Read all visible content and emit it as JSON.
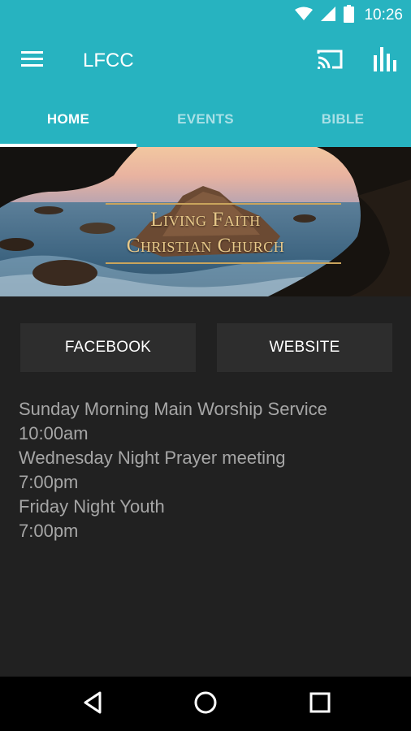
{
  "status_bar": {
    "time": "10:26",
    "icons": [
      "wifi-icon",
      "cell-signal-icon",
      "battery-icon"
    ]
  },
  "app_bar": {
    "title": "LFCC",
    "icons": [
      "menu-icon",
      "cast-icon",
      "bar-chart-icon"
    ],
    "background_color": "#27b3c0"
  },
  "tabs": [
    {
      "label": "HOME",
      "active": true
    },
    {
      "label": "EVENTS",
      "active": false
    },
    {
      "label": "BIBLE",
      "active": false
    }
  ],
  "banner": {
    "line1": "Living Faith",
    "line2": "Christian Church"
  },
  "buttons": {
    "facebook_label": "FACEBOOK",
    "website_label": "WEBSITE"
  },
  "schedule": [
    "Sunday Morning Main Worship Service",
    "10:00am",
    "Wednesday Night Prayer meeting",
    "7:00pm",
    "Friday Night Youth",
    "7:00pm"
  ],
  "nav_bar": {
    "icons": [
      "back-icon",
      "home-icon",
      "recents-icon"
    ]
  }
}
